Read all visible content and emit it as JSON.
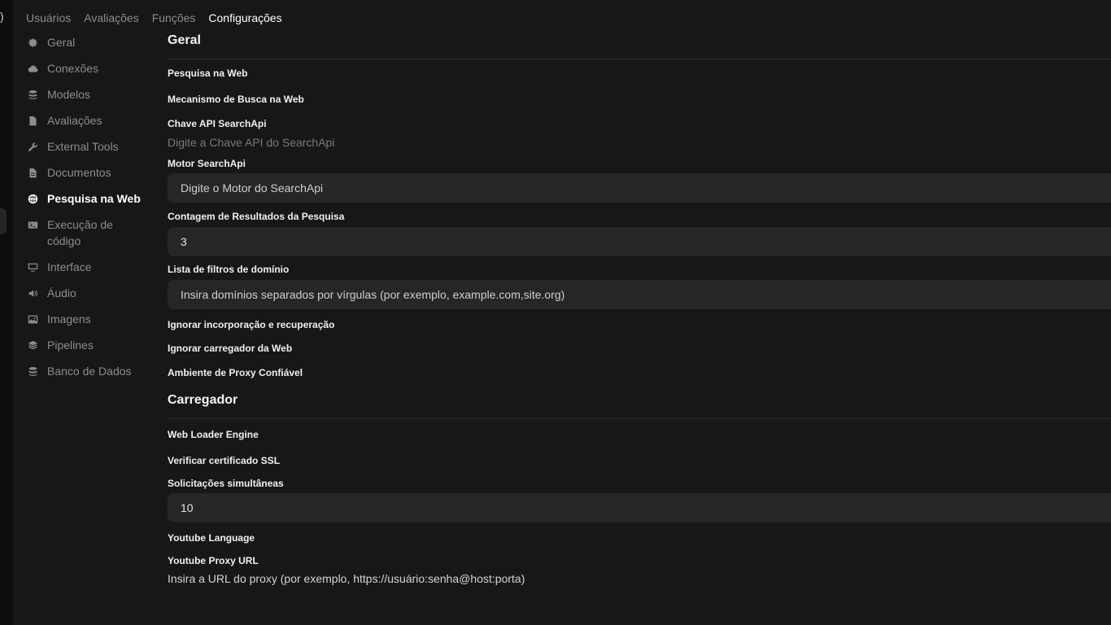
{
  "tabs": [
    "Usuários",
    "Avaliações",
    "Funções",
    "Configurações"
  ],
  "sidebar": {
    "items": [
      {
        "label": "Geral",
        "icon": "gear-icon"
      },
      {
        "label": "Conexões",
        "icon": "cloud-icon"
      },
      {
        "label": "Modelos",
        "icon": "stack-icon"
      },
      {
        "label": "Avaliações",
        "icon": "document-icon"
      },
      {
        "label": "External Tools",
        "icon": "wrench-icon"
      },
      {
        "label": "Documentos",
        "icon": "document-text-icon"
      },
      {
        "label": "Pesquisa na Web",
        "icon": "globe-icon",
        "active": true
      },
      {
        "label": "Execução de código",
        "icon": "terminal-icon"
      },
      {
        "label": "Interface",
        "icon": "monitor-icon"
      },
      {
        "label": "Áudio",
        "icon": "speaker-icon"
      },
      {
        "label": "Imagens",
        "icon": "image-icon"
      },
      {
        "label": "Pipelines",
        "icon": "layers-icon"
      },
      {
        "label": "Banco de Dados",
        "icon": "database-icon"
      }
    ]
  },
  "main": {
    "section_general": "Geral",
    "web_search_label": "Pesquisa na Web",
    "search_engine_label": "Mecanismo de Busca na Web",
    "api_key_label": "Chave API SearchApi",
    "api_key_placeholder": "Digite a Chave API do SearchApi",
    "engine_label": "Motor SearchApi",
    "engine_placeholder": "Digite o Motor do SearchApi",
    "result_count_label": "Contagem de Resultados da Pesquisa",
    "result_count_value": "3",
    "domain_filter_label": "Lista de filtros de domínio",
    "domain_filter_placeholder": "Insira domínios separados por vírgulas (por exemplo, example.com,site.org)",
    "bypass_embedding_label": "Ignorar incorporação e recuperação",
    "bypass_loader_label": "Ignorar carregador da Web",
    "trust_proxy_label": "Ambiente de Proxy Confiável",
    "section_loader": "Carregador",
    "loader_engine_label": "Web Loader Engine",
    "verify_ssl_label": "Verificar certificado SSL",
    "concurrent_label": "Solicitações simultâneas",
    "concurrent_value": "10",
    "youtube_language_label": "Youtube Language",
    "youtube_proxy_label": "Youtube Proxy URL",
    "youtube_proxy_placeholder": "Insira a URL do proxy (por exemplo, https://usuário:senha@host:porta)"
  }
}
